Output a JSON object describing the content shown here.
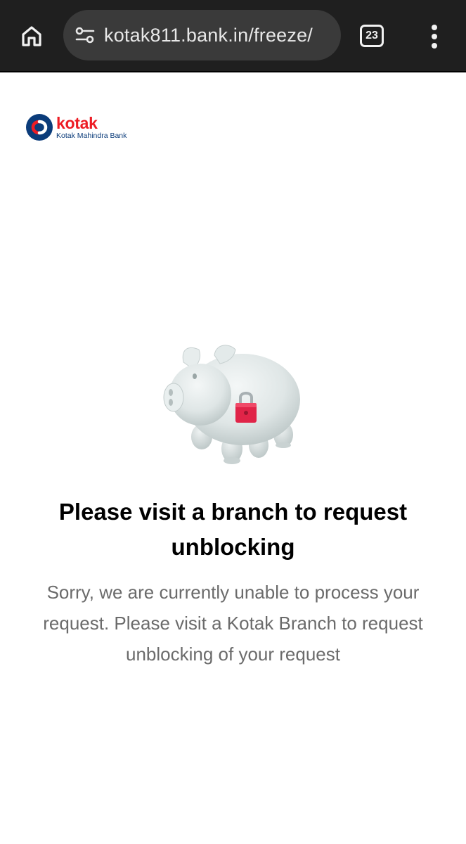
{
  "browser": {
    "url": "kotak811.bank.in/freeze/",
    "tab_count": "23"
  },
  "logo": {
    "brand": "kotak",
    "subtitle": "Kotak Mahindra Bank"
  },
  "content": {
    "title": "Please visit a branch to request unblocking",
    "message": "Sorry, we are currently unable to process your request. Please visit a Kotak Branch to request unblocking of your request"
  },
  "colors": {
    "brand_red": "#ed1c24",
    "brand_blue": "#0b3c7a",
    "lock_red": "#e02448",
    "toolbar": "#1f1f1f"
  },
  "icons": {
    "home": "home-icon",
    "site_settings": "tune-icon",
    "menu": "more-vert-icon",
    "illustration": "locked-piggy-bank"
  }
}
